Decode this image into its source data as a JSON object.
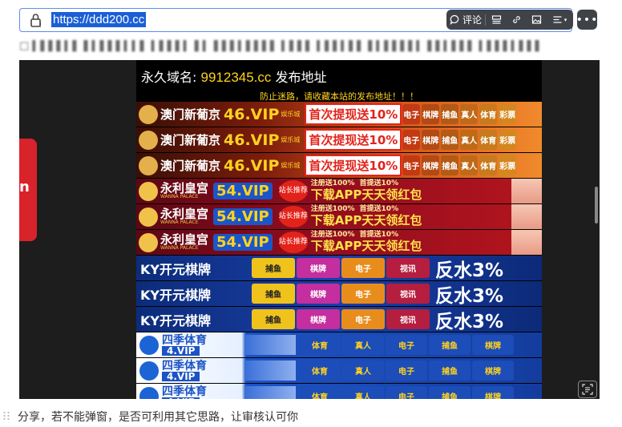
{
  "address_bar": {
    "url": "https://ddd200.cc"
  },
  "toolbar": {
    "comment_label": "评论"
  },
  "blurred_line": "□ ▍▌▌▌▍▌ ▌▍▌▌▌▍▍▌ ▍▌▌▌▍ ▌▍ ▌▌▌▍▌▌▌▌ ▍▌▌▌ ▍▌▌▍▌▌ ▌▍▌▌▌▌▍ ▌▌▍▌▌▌ ▍▌▌▌▍▌▌▌",
  "embedded_page": {
    "domain_label": "永久域名:",
    "domain_value": "9912345.cc",
    "domain_suffix": "发布地址",
    "notice": "防止迷路，请收藏本站的发布地址！！！",
    "left_strip_text": "n",
    "banner_groups": [
      {
        "logo": "澳门新葡京",
        "vip": "46.VIP",
        "sub": "娱乐城",
        "slogan": "首次提现",
        "slogan2": "送10%",
        "chips": [
          "电子",
          "棋牌",
          "捕鱼",
          "真人",
          "体育",
          "彩票"
        ]
      },
      {
        "logo": "永利皇宫",
        "vip": "54.VIP",
        "sub": "WANNA PALACE",
        "badge": "站长推荐",
        "slogan": "注册送100%",
        "slogan2": "首提送10%",
        "headline": "下载APP天天领红包"
      },
      {
        "logo": "KY开元棋牌",
        "chips": [
          "捕鱼",
          "棋牌",
          "电子",
          "视讯"
        ],
        "headline": "反水3%"
      },
      {
        "logo": "四季体育",
        "vip": "4.VIP",
        "chips": [
          "体育",
          "真人",
          "电子",
          "捕鱼",
          "棋牌"
        ]
      }
    ]
  },
  "caption": "分享，若不能弹窗，是否可利用其它思路，让审核认可你"
}
